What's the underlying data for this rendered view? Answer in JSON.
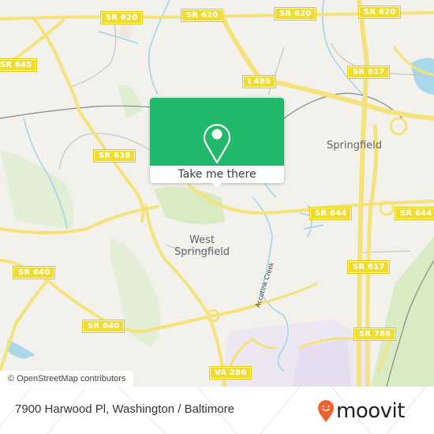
{
  "map": {
    "road_labels": [
      {
        "id": "sr620-a",
        "text": "SR 620"
      },
      {
        "id": "sr620-b",
        "text": "SR 620"
      },
      {
        "id": "sr620-c",
        "text": "SR 620"
      },
      {
        "id": "sr620-d",
        "text": "SR 620"
      },
      {
        "id": "sr645",
        "text": "SR 645"
      },
      {
        "id": "i495",
        "text": "I 495"
      },
      {
        "id": "sr617-a",
        "text": "SR 617"
      },
      {
        "id": "sr638",
        "text": "SR 638"
      },
      {
        "id": "sr644-a",
        "text": "SR 644"
      },
      {
        "id": "sr644-b",
        "text": "SR 644"
      },
      {
        "id": "sr640-a",
        "text": "SR 640"
      },
      {
        "id": "sr640-b",
        "text": "SR 640"
      },
      {
        "id": "sr617-b",
        "text": "SR 617"
      },
      {
        "id": "sr789",
        "text": "SR 789"
      },
      {
        "id": "va286",
        "text": "VA 286"
      }
    ],
    "places": {
      "springfield": "Springfield",
      "west_springfield_line1": "West",
      "west_springfield_line2": "Springfield"
    },
    "waterway": "Accotink Creek",
    "colors": {
      "background": "#f2f1ec",
      "road": "#f6e27a",
      "shield": "#f0dc2e",
      "water": "#a8d8ea",
      "park": "#d8ebc3",
      "industrial": "#ebe6f4",
      "popup_green": "#20b86a"
    }
  },
  "popup": {
    "icon": "location-pin-icon",
    "button_label": "Take me there"
  },
  "attribution": "© OpenStreetMap contributors",
  "footer": {
    "address": "7900 Harwood Pl, Washington / Baltimore",
    "brand": "moovit",
    "brand_icon": "moovit-pin-icon",
    "brand_color": "#f2612f"
  }
}
